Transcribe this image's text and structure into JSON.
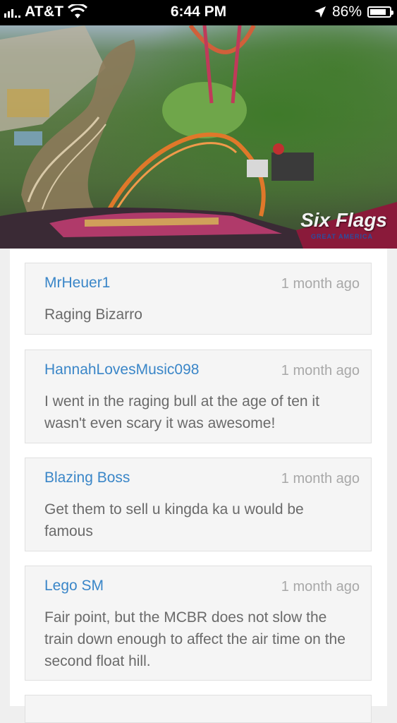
{
  "status_bar": {
    "carrier": "AT&T",
    "time": "6:44 PM",
    "battery": "86%",
    "battery_level": 0.86
  },
  "hero": {
    "brand": "Six Flags",
    "brand_sub": "GREAT AMERICA"
  },
  "comments": [
    {
      "author": "MrHeuer1",
      "time": "1 month ago",
      "text": "Raging Bizarro"
    },
    {
      "author": "HannahLovesMusic098",
      "time": "1 month ago",
      "text": "I went in the raging bull at the age of ten it wasn't even scary it was awesome!"
    },
    {
      "author": "Blazing Boss",
      "time": "1 month ago",
      "text": "Get them to sell u kingda ka u would be famous"
    },
    {
      "author": "Lego SM",
      "time": "1 month ago",
      "text": "Fair point, but the MCBR does not slow the train down enough to affect the air time on the second float hill."
    }
  ]
}
